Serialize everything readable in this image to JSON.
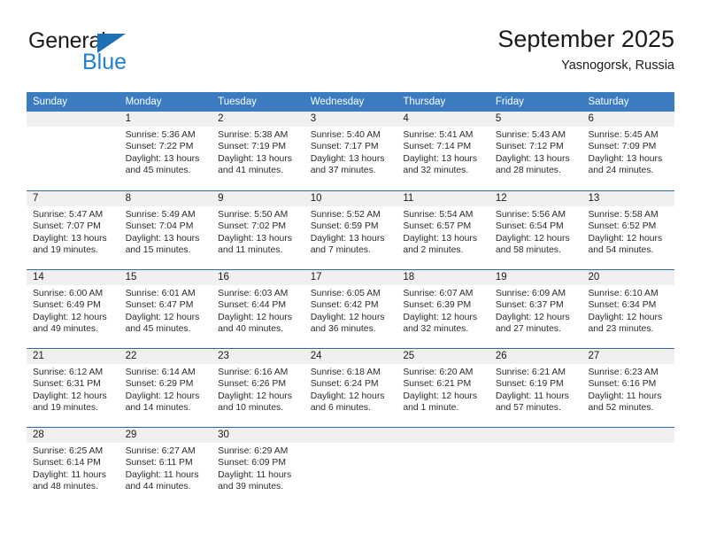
{
  "brand": {
    "name_top": "General",
    "name_bottom": "Blue",
    "triangle_icon": "blue-triangle-logo-mark",
    "color_top": "#1a1a1a",
    "color_bottom": "#1f7fd4"
  },
  "header": {
    "title": "September 2025",
    "subtitle": "Yasnogorsk, Russia"
  },
  "theme": {
    "header_blue": "#3b7cc0",
    "row_divider_blue": "#2e6cab",
    "day_band_gray": "#f0f0f0",
    "text_color": "#1a1a1a"
  },
  "weekdays": [
    "Sunday",
    "Monday",
    "Tuesday",
    "Wednesday",
    "Thursday",
    "Friday",
    "Saturday"
  ],
  "weeks": [
    [
      {
        "day": "",
        "lines": []
      },
      {
        "day": "1",
        "lines": [
          "Sunrise: 5:36 AM",
          "Sunset: 7:22 PM",
          "Daylight: 13 hours",
          "and 45 minutes."
        ]
      },
      {
        "day": "2",
        "lines": [
          "Sunrise: 5:38 AM",
          "Sunset: 7:19 PM",
          "Daylight: 13 hours",
          "and 41 minutes."
        ]
      },
      {
        "day": "3",
        "lines": [
          "Sunrise: 5:40 AM",
          "Sunset: 7:17 PM",
          "Daylight: 13 hours",
          "and 37 minutes."
        ]
      },
      {
        "day": "4",
        "lines": [
          "Sunrise: 5:41 AM",
          "Sunset: 7:14 PM",
          "Daylight: 13 hours",
          "and 32 minutes."
        ]
      },
      {
        "day": "5",
        "lines": [
          "Sunrise: 5:43 AM",
          "Sunset: 7:12 PM",
          "Daylight: 13 hours",
          "and 28 minutes."
        ]
      },
      {
        "day": "6",
        "lines": [
          "Sunrise: 5:45 AM",
          "Sunset: 7:09 PM",
          "Daylight: 13 hours",
          "and 24 minutes."
        ]
      }
    ],
    [
      {
        "day": "7",
        "lines": [
          "Sunrise: 5:47 AM",
          "Sunset: 7:07 PM",
          "Daylight: 13 hours",
          "and 19 minutes."
        ]
      },
      {
        "day": "8",
        "lines": [
          "Sunrise: 5:49 AM",
          "Sunset: 7:04 PM",
          "Daylight: 13 hours",
          "and 15 minutes."
        ]
      },
      {
        "day": "9",
        "lines": [
          "Sunrise: 5:50 AM",
          "Sunset: 7:02 PM",
          "Daylight: 13 hours",
          "and 11 minutes."
        ]
      },
      {
        "day": "10",
        "lines": [
          "Sunrise: 5:52 AM",
          "Sunset: 6:59 PM",
          "Daylight: 13 hours",
          "and 7 minutes."
        ]
      },
      {
        "day": "11",
        "lines": [
          "Sunrise: 5:54 AM",
          "Sunset: 6:57 PM",
          "Daylight: 13 hours",
          "and 2 minutes."
        ]
      },
      {
        "day": "12",
        "lines": [
          "Sunrise: 5:56 AM",
          "Sunset: 6:54 PM",
          "Daylight: 12 hours",
          "and 58 minutes."
        ]
      },
      {
        "day": "13",
        "lines": [
          "Sunrise: 5:58 AM",
          "Sunset: 6:52 PM",
          "Daylight: 12 hours",
          "and 54 minutes."
        ]
      }
    ],
    [
      {
        "day": "14",
        "lines": [
          "Sunrise: 6:00 AM",
          "Sunset: 6:49 PM",
          "Daylight: 12 hours",
          "and 49 minutes."
        ]
      },
      {
        "day": "15",
        "lines": [
          "Sunrise: 6:01 AM",
          "Sunset: 6:47 PM",
          "Daylight: 12 hours",
          "and 45 minutes."
        ]
      },
      {
        "day": "16",
        "lines": [
          "Sunrise: 6:03 AM",
          "Sunset: 6:44 PM",
          "Daylight: 12 hours",
          "and 40 minutes."
        ]
      },
      {
        "day": "17",
        "lines": [
          "Sunrise: 6:05 AM",
          "Sunset: 6:42 PM",
          "Daylight: 12 hours",
          "and 36 minutes."
        ]
      },
      {
        "day": "18",
        "lines": [
          "Sunrise: 6:07 AM",
          "Sunset: 6:39 PM",
          "Daylight: 12 hours",
          "and 32 minutes."
        ]
      },
      {
        "day": "19",
        "lines": [
          "Sunrise: 6:09 AM",
          "Sunset: 6:37 PM",
          "Daylight: 12 hours",
          "and 27 minutes."
        ]
      },
      {
        "day": "20",
        "lines": [
          "Sunrise: 6:10 AM",
          "Sunset: 6:34 PM",
          "Daylight: 12 hours",
          "and 23 minutes."
        ]
      }
    ],
    [
      {
        "day": "21",
        "lines": [
          "Sunrise: 6:12 AM",
          "Sunset: 6:31 PM",
          "Daylight: 12 hours",
          "and 19 minutes."
        ]
      },
      {
        "day": "22",
        "lines": [
          "Sunrise: 6:14 AM",
          "Sunset: 6:29 PM",
          "Daylight: 12 hours",
          "and 14 minutes."
        ]
      },
      {
        "day": "23",
        "lines": [
          "Sunrise: 6:16 AM",
          "Sunset: 6:26 PM",
          "Daylight: 12 hours",
          "and 10 minutes."
        ]
      },
      {
        "day": "24",
        "lines": [
          "Sunrise: 6:18 AM",
          "Sunset: 6:24 PM",
          "Daylight: 12 hours",
          "and 6 minutes."
        ]
      },
      {
        "day": "25",
        "lines": [
          "Sunrise: 6:20 AM",
          "Sunset: 6:21 PM",
          "Daylight: 12 hours",
          "and 1 minute."
        ]
      },
      {
        "day": "26",
        "lines": [
          "Sunrise: 6:21 AM",
          "Sunset: 6:19 PM",
          "Daylight: 11 hours",
          "and 57 minutes."
        ]
      },
      {
        "day": "27",
        "lines": [
          "Sunrise: 6:23 AM",
          "Sunset: 6:16 PM",
          "Daylight: 11 hours",
          "and 52 minutes."
        ]
      }
    ],
    [
      {
        "day": "28",
        "lines": [
          "Sunrise: 6:25 AM",
          "Sunset: 6:14 PM",
          "Daylight: 11 hours",
          "and 48 minutes."
        ]
      },
      {
        "day": "29",
        "lines": [
          "Sunrise: 6:27 AM",
          "Sunset: 6:11 PM",
          "Daylight: 11 hours",
          "and 44 minutes."
        ]
      },
      {
        "day": "30",
        "lines": [
          "Sunrise: 6:29 AM",
          "Sunset: 6:09 PM",
          "Daylight: 11 hours",
          "and 39 minutes."
        ]
      },
      {
        "day": "",
        "lines": []
      },
      {
        "day": "",
        "lines": []
      },
      {
        "day": "",
        "lines": []
      },
      {
        "day": "",
        "lines": []
      }
    ]
  ]
}
